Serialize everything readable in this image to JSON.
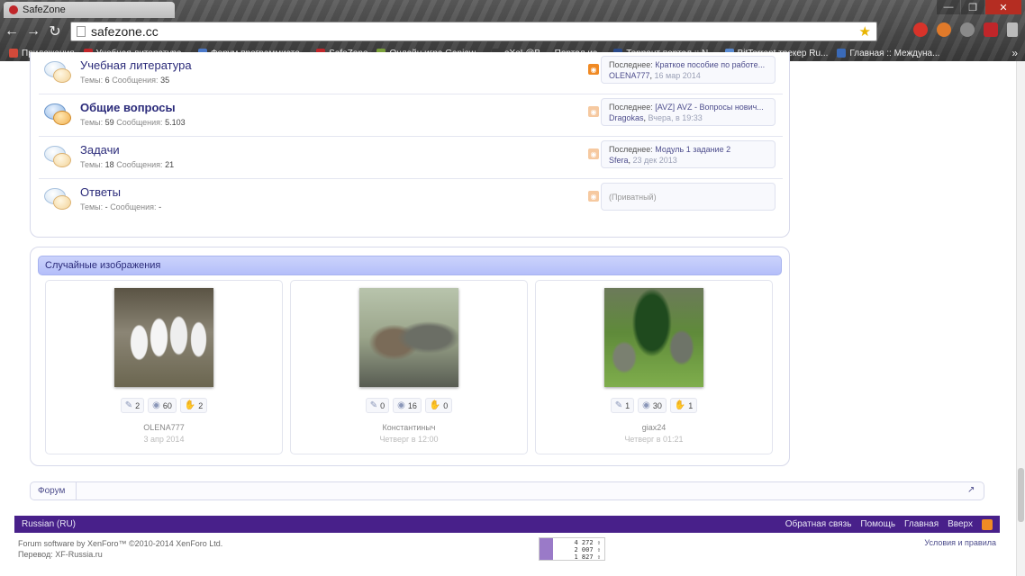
{
  "browser": {
    "tab_title": "SafeZone",
    "url": "safezone.cc",
    "bookmarks": [
      {
        "label": "Приложения",
        "color": "#d24a3a"
      },
      {
        "label": "Учебная литература...",
        "color": "#c0262a"
      },
      {
        "label": "Форум программисто...",
        "color": "#4a78c8"
      },
      {
        "label": "SafeZone",
        "color": "#c0262a"
      },
      {
        "label": "Онлайн игра Ganjaw...",
        "color": "#7aa03a"
      },
      {
        "label": "eXeL@B — Портал ис...",
        "color": "#3a3a3a"
      },
      {
        "label": "Торрент портал :: N...",
        "color": "#2a4a8a"
      },
      {
        "label": "BitTorrent трекер Ru...",
        "color": "#5a8ad0"
      },
      {
        "label": "Главная :: Междуна...",
        "color": "#3a6ab8"
      }
    ],
    "bookmarks_more": "»"
  },
  "forum_nodes": [
    {
      "title": "Учебная литература",
      "threads_label": "Темы:",
      "threads": "6",
      "posts_label": "Сообщения:",
      "posts": "35",
      "unread": false,
      "rss_active": true,
      "last_label": "Последнее:",
      "last_thread": "Краткое пособие по работе...",
      "last_user": "OLENA777",
      "last_date": "16 мар 2014"
    },
    {
      "title": "Общие вопросы",
      "threads_label": "Темы:",
      "threads": "59",
      "posts_label": "Сообщения:",
      "posts": "5.103",
      "unread": true,
      "rss_active": false,
      "last_label": "Последнее:",
      "last_thread": "[AVZ] AVZ - Вопросы нович...",
      "last_user": "Dragokas",
      "last_date": "Вчера, в 19:33"
    },
    {
      "title": "Задачи",
      "threads_label": "Темы:",
      "threads": "18",
      "posts_label": "Сообщения:",
      "posts": "21",
      "unread": false,
      "rss_active": false,
      "last_label": "Последнее:",
      "last_thread": "Модуль 1 задание 2",
      "last_user": "Sfera",
      "last_date": "23 дек 2013"
    },
    {
      "title": "Ответы",
      "threads_label": "Темы:",
      "threads": "-",
      "posts_label": "Сообщения:",
      "posts": "-",
      "unread": false,
      "rss_active": false,
      "private": "(Приватный)"
    }
  ],
  "random_images": {
    "header": "Случайные изображения",
    "items": [
      {
        "image": "geese",
        "comments": "2",
        "views": "60",
        "likes": "2",
        "author": "OLENA777",
        "date": "3 апр 2014"
      },
      {
        "image": "chair",
        "comments": "0",
        "views": "16",
        "likes": "0",
        "author": "Константиныч",
        "date": "Четверг в 12:00"
      },
      {
        "image": "garden",
        "comments": "1",
        "views": "30",
        "likes": "1",
        "author": "giax24",
        "date": "Четверг в 01:21"
      }
    ]
  },
  "breadcrumb": {
    "home": "Форум"
  },
  "footer": {
    "language": "Russian (RU)",
    "links": [
      "Обратная связь",
      "Помощь",
      "Главная",
      "Вверх"
    ],
    "copyright": "Forum software by XenForo™ ©2010-2014 XenForo Ltd.",
    "translation": "Перевод: XF-Russia.ru",
    "terms": "Условия и правила",
    "counter": [
      "4 272 ⇧",
      "2 007 ⇧",
      "1 827 ⇧"
    ]
  }
}
